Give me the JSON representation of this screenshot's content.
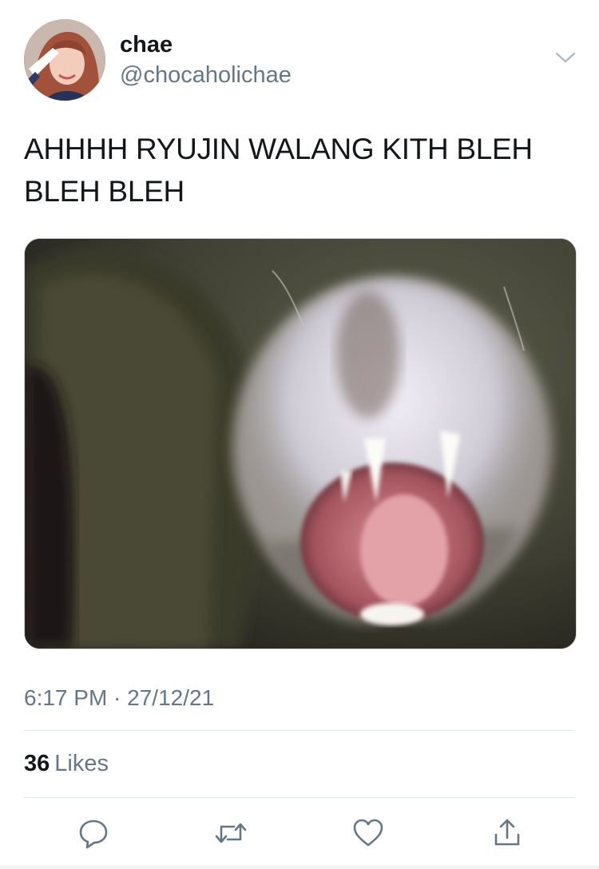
{
  "tweet": {
    "author": {
      "display_name": "chae",
      "handle": "@chocaholichae",
      "avatar_icon": "profile-photo"
    },
    "text": "AHHHH RYUJIN WALANG KITH BLEH\nBLEH BLEH",
    "media": {
      "kind": "photo",
      "subject": "cat-yawning-photo"
    },
    "timestamp": "6:17 PM · 27/12/21",
    "likes": {
      "count": "36",
      "label": "Likes"
    },
    "actions": [
      {
        "name": "reply",
        "icon": "speech-bubble-icon"
      },
      {
        "name": "retweet",
        "icon": "retweet-arrows-icon"
      },
      {
        "name": "like",
        "icon": "heart-icon"
      },
      {
        "name": "share",
        "icon": "share-upload-icon"
      }
    ]
  },
  "colors": {
    "text_primary": "#14171a",
    "text_secondary": "#657786",
    "divider": "#e1e8ed"
  }
}
